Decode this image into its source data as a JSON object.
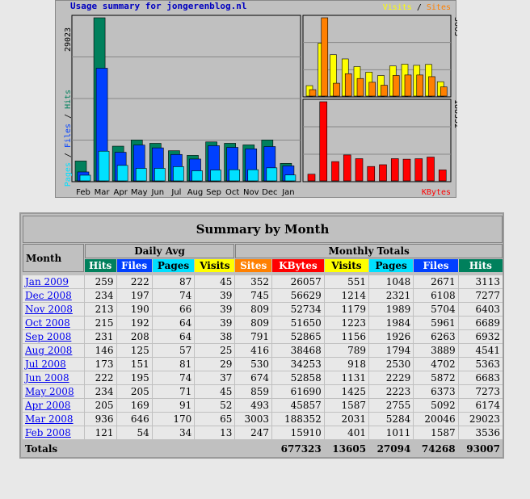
{
  "graph": {
    "title": "Usage summary for jongerenblog.nl",
    "legend_left": [
      "Pages",
      "Files",
      "Hits"
    ],
    "legend_right_top": [
      "Visits",
      "Sites"
    ],
    "legend_right_bottom": "KBytes",
    "left_max_label": "29023",
    "right_top_max_label": "3003",
    "right_bottom_max_label": "188352",
    "months": [
      "Feb",
      "Mar",
      "Apr",
      "May",
      "Jun",
      "Jul",
      "Aug",
      "Sep",
      "Oct",
      "Nov",
      "Dec",
      "Jan"
    ]
  },
  "colors": {
    "hits": "#00805c",
    "files": "#0040ff",
    "pages": "#00e0ff",
    "visits": "#ffff00",
    "sites": "#ff8000",
    "kbytes": "#ff0000"
  },
  "chart_data": {
    "type": "bar",
    "categories": [
      "Feb",
      "Mar",
      "Apr",
      "May",
      "Jun",
      "Jul",
      "Aug",
      "Sep",
      "Oct",
      "Nov",
      "Dec",
      "Jan"
    ],
    "series": [
      {
        "name": "Hits",
        "values": [
          3536,
          29023,
          6174,
          7273,
          6683,
          5363,
          4541,
          6932,
          6689,
          6403,
          7277,
          3113
        ]
      },
      {
        "name": "Files",
        "values": [
          1587,
          20046,
          5092,
          6373,
          5872,
          4702,
          3889,
          6263,
          5961,
          5704,
          6108,
          2671
        ]
      },
      {
        "name": "Pages",
        "values": [
          1011,
          5284,
          2755,
          2223,
          2229,
          2530,
          1794,
          1926,
          1984,
          1989,
          2321,
          1048
        ]
      },
      {
        "name": "Visits",
        "values": [
          401,
          2031,
          1587,
          1425,
          1131,
          918,
          789,
          1156,
          1223,
          1179,
          1214,
          551
        ]
      },
      {
        "name": "Sites",
        "values": [
          247,
          3003,
          493,
          859,
          674,
          530,
          416,
          791,
          809,
          809,
          745,
          352
        ]
      },
      {
        "name": "KBytes",
        "values": [
          15910,
          188352,
          45857,
          61690,
          52858,
          34253,
          38468,
          52865,
          51650,
          52734,
          56629,
          26057
        ]
      }
    ],
    "title": "Usage summary for jongerenblog.nl",
    "ylim_left": [
      0,
      29023
    ],
    "ylim_right_top": [
      0,
      3003
    ],
    "ylim_right_bottom": [
      0,
      188352
    ]
  },
  "summary": {
    "title": "Summary by Month",
    "month_header": "Month",
    "daily_avg_header": "Daily Avg",
    "monthly_totals_header": "Monthly Totals",
    "daily_cols": [
      "Hits",
      "Files",
      "Pages",
      "Visits"
    ],
    "monthly_cols": [
      "Sites",
      "KBytes",
      "Visits",
      "Pages",
      "Files",
      "Hits"
    ],
    "rows": [
      {
        "month": "Jan 2009",
        "d": [
          "259",
          "222",
          "87",
          "45"
        ],
        "t": [
          "352",
          "26057",
          "551",
          "1048",
          "2671",
          "3113"
        ]
      },
      {
        "month": "Dec 2008",
        "d": [
          "234",
          "197",
          "74",
          "39"
        ],
        "t": [
          "745",
          "56629",
          "1214",
          "2321",
          "6108",
          "7277"
        ]
      },
      {
        "month": "Nov 2008",
        "d": [
          "213",
          "190",
          "66",
          "39"
        ],
        "t": [
          "809",
          "52734",
          "1179",
          "1989",
          "5704",
          "6403"
        ]
      },
      {
        "month": "Oct 2008",
        "d": [
          "215",
          "192",
          "64",
          "39"
        ],
        "t": [
          "809",
          "51650",
          "1223",
          "1984",
          "5961",
          "6689"
        ]
      },
      {
        "month": "Sep 2008",
        "d": [
          "231",
          "208",
          "64",
          "38"
        ],
        "t": [
          "791",
          "52865",
          "1156",
          "1926",
          "6263",
          "6932"
        ]
      },
      {
        "month": "Aug 2008",
        "d": [
          "146",
          "125",
          "57",
          "25"
        ],
        "t": [
          "416",
          "38468",
          "789",
          "1794",
          "3889",
          "4541"
        ]
      },
      {
        "month": "Jul 2008",
        "d": [
          "173",
          "151",
          "81",
          "29"
        ],
        "t": [
          "530",
          "34253",
          "918",
          "2530",
          "4702",
          "5363"
        ]
      },
      {
        "month": "Jun 2008",
        "d": [
          "222",
          "195",
          "74",
          "37"
        ],
        "t": [
          "674",
          "52858",
          "1131",
          "2229",
          "5872",
          "6683"
        ]
      },
      {
        "month": "May 2008",
        "d": [
          "234",
          "205",
          "71",
          "45"
        ],
        "t": [
          "859",
          "61690",
          "1425",
          "2223",
          "6373",
          "7273"
        ]
      },
      {
        "month": "Apr 2008",
        "d": [
          "205",
          "169",
          "91",
          "52"
        ],
        "t": [
          "493",
          "45857",
          "1587",
          "2755",
          "5092",
          "6174"
        ]
      },
      {
        "month": "Mar 2008",
        "d": [
          "936",
          "646",
          "170",
          "65"
        ],
        "t": [
          "3003",
          "188352",
          "2031",
          "5284",
          "20046",
          "29023"
        ]
      },
      {
        "month": "Feb 2008",
        "d": [
          "121",
          "54",
          "34",
          "13"
        ],
        "t": [
          "247",
          "15910",
          "401",
          "1011",
          "1587",
          "3536"
        ]
      }
    ],
    "totals_label": "Totals",
    "totals": [
      "677323",
      "13605",
      "27094",
      "74268",
      "93007"
    ]
  }
}
